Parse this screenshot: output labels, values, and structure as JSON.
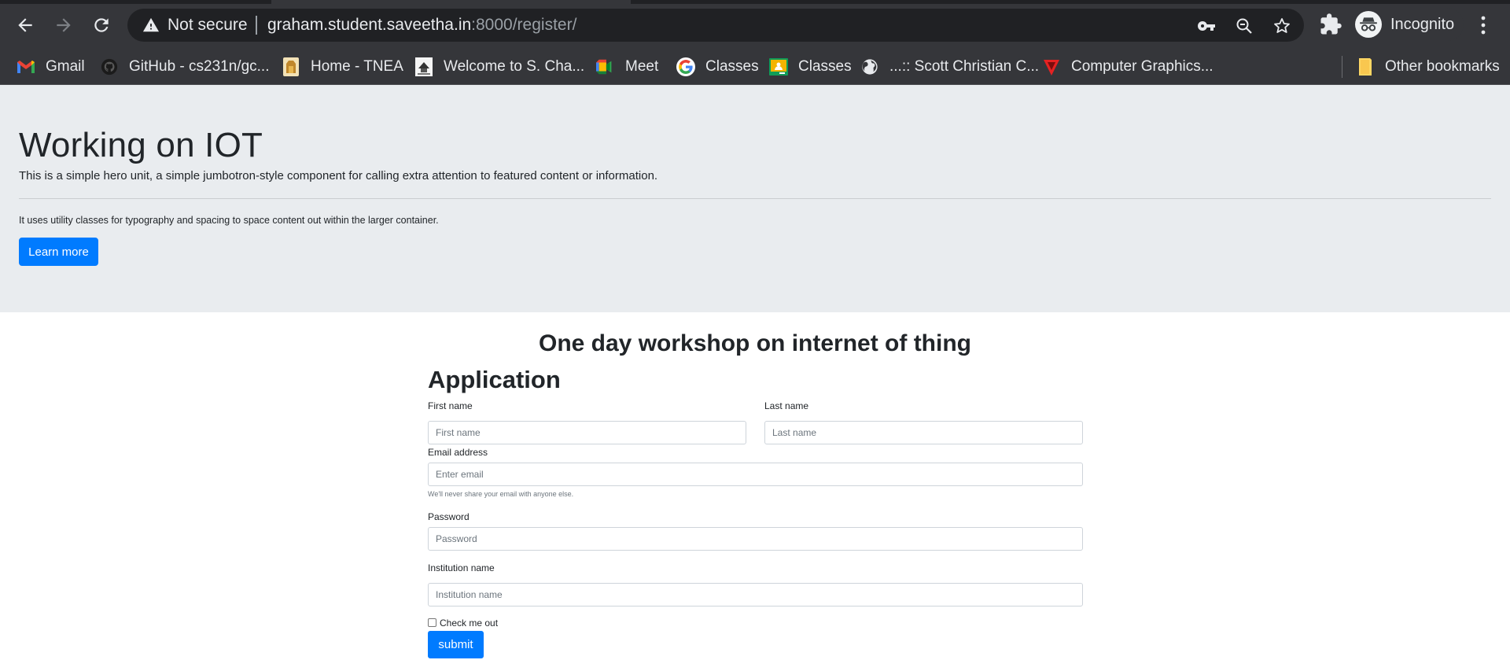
{
  "browser": {
    "not_secure_label": "Not secure",
    "url_host": "graham.student.saveetha.in",
    "url_rest": ":8000/register/",
    "profile_label": "Incognito",
    "bookmarks": [
      {
        "label": "Gmail",
        "icon": "gmail-icon"
      },
      {
        "label": "GitHub - cs231n/gc...",
        "icon": "github-icon"
      },
      {
        "label": "Home - TNEA",
        "icon": "tnea-icon"
      },
      {
        "label": "Welcome to S. Cha...",
        "icon": "college-icon"
      },
      {
        "label": "Meet",
        "icon": "meet-icon"
      },
      {
        "label": "Classes",
        "icon": "google-icon"
      },
      {
        "label": "Classes",
        "icon": "classroom-icon"
      },
      {
        "label": "...:: Scott Christian C...",
        "icon": "globe-icon"
      },
      {
        "label": "Computer Graphics...",
        "icon": "graphics-icon"
      }
    ],
    "other_bookmarks_label": "Other bookmarks"
  },
  "hero": {
    "title": "Working on IOT",
    "lead": "This is a simple hero unit, a simple jumbotron-style component for calling extra attention to featured content or information.",
    "text": "It uses utility classes for typography and spacing to space content out within the larger container.",
    "button_label": "Learn more"
  },
  "form": {
    "title": "One day workshop on internet of thing",
    "heading": "Application",
    "first_name": {
      "label": "First name",
      "placeholder": "First name"
    },
    "last_name": {
      "label": "Last name",
      "placeholder": "Last name"
    },
    "email": {
      "label": "Email address",
      "placeholder": "Enter email",
      "help": "We'll never share your email with anyone else."
    },
    "password": {
      "label": "Password",
      "placeholder": "Password"
    },
    "institution": {
      "label": "Institution name",
      "placeholder": "Institution name"
    },
    "checkbox_label": "Check me out",
    "submit_label": "submit"
  },
  "colors": {
    "primary": "#007bff",
    "jumbotron_bg": "#e9ecef",
    "chrome_bg": "#35363a",
    "omnibox_bg": "#202124"
  }
}
